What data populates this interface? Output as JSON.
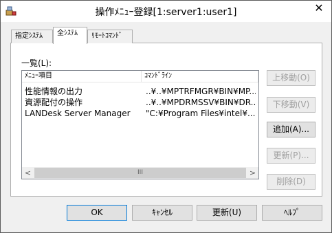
{
  "window": {
    "title": "操作ﾒﾆｭｰ登録[1:server1:user1]",
    "close_glyph": "✕"
  },
  "tabs": [
    {
      "label": "指定ｼｽﾃﾑ",
      "active": false
    },
    {
      "label": "全ｼｽﾃﾑ",
      "active": true
    },
    {
      "label": "ﾘﾓｰﾄｺﾏﾝﾄﾞ",
      "active": false
    }
  ],
  "list": {
    "label": "一覧(L):",
    "columns": [
      "ﾒﾆｭｰ項目",
      "ｺﾏﾝﾄﾞﾗｲﾝ"
    ],
    "rows": [
      {
        "item": "性能情報の出力",
        "command": "..¥..¥MPTRFMGR¥BIN¥MP..."
      },
      {
        "item": "資源配付の操作",
        "command": "..¥..¥MPDRMSSV¥BIN¥DR..."
      },
      {
        "item": "LANDesk Server Manager",
        "command": "\"C:¥Program Files¥intel¥..."
      }
    ],
    "scroll_left": "<",
    "scroll_right": ">",
    "scroll_grip": "III"
  },
  "side_buttons": {
    "move_up": "上移動(O)",
    "move_down": "下移動(V)",
    "add": "追加(A)...",
    "update": "更新(P)...",
    "delete": "削除(D)"
  },
  "bottom_buttons": {
    "ok": "OK",
    "cancel": "ｷｬﾝｾﾙ",
    "apply": "更新(U)",
    "help": "ﾍﾙﾌﾟ"
  }
}
